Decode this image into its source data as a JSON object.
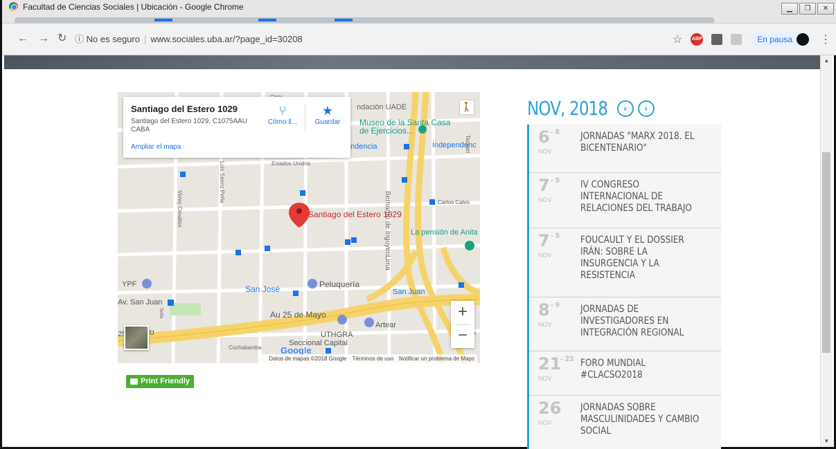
{
  "window": {
    "title": "Facultad de Ciencias Sociales | Ubicación - Google Chrome"
  },
  "address_bar": {
    "security": "No es seguro",
    "url": "www.sociales.uba.ar/?page_id=30208",
    "profile_status": "En pausa"
  },
  "map": {
    "place_name": "Santiago del Estero 1029",
    "address_line": "Santiago del Estero 1029, C1075AAU CABA",
    "directions_label": "Cómo ll...",
    "save_label": "Guardar",
    "enlarge_label": "Ampliar el mapa",
    "marker_label": "Santiago del Estero 1029",
    "labels": {
      "chile": "Chile",
      "uade": "ndación UADE",
      "museo": "Museo de la Santa Casa de Ejercicios...",
      "independencia1": "ndencia",
      "independencia2": "Independenc",
      "estados_unidos": "Estados Unidos",
      "bernardo": "Bernardo de Irigoyen",
      "carlos_calvo": "Carlos Calvo",
      "virrey": "Virrey Cevallos",
      "luis_saenz": "Luis Sáenz Peña",
      "pension": "La pensión de Anita",
      "lima": "Lima",
      "ypf": "YPF",
      "san_jose": "San José",
      "peluqueria": "Peluquería",
      "san_juan_metro": "San Juan",
      "av_san_juan": "Av. San Juan",
      "solis": "Solís",
      "au25": "Au 25 de Mayo",
      "yo": "yo",
      "num25": "25",
      "artear": "Artear",
      "uthgra": "UTHGRA",
      "seccional": "Seccional Capital",
      "cochabamba": "Cochabamba",
      "tacuari": "Tacuarí",
      "ba": "ba"
    },
    "google_logo": "Google",
    "attribution": [
      "Datos de mapas ©2018 Google",
      "Términos de uso",
      "Notificar un problema de Maps"
    ]
  },
  "print_button": "Print Friendly",
  "calendar": {
    "month_label": "NOV, 2018",
    "prev_icon": "chevron-left-icon",
    "next_icon": "chevron-right-icon",
    "events": [
      {
        "day": "6",
        "end": "- 8",
        "month": "NOV",
        "title": "JORNADAS \"MARX 2018. EL BICENTENARIO\""
      },
      {
        "day": "7",
        "end": "- 9",
        "month": "NOV",
        "title": "IV CONGRESO INTERNACIONAL DE RELACIONES DEL TRABAJO"
      },
      {
        "day": "7",
        "end": "- 9",
        "month": "NOV",
        "title": "FOUCAULT Y EL DOSSIER IRÁN: SOBRE LA INSURGENCIA Y LA RESISTENCIA"
      },
      {
        "day": "8",
        "end": "- 9",
        "month": "NOV",
        "title": "JORNADAS DE INVESTIGADORES EN INTEGRACIÓN REGIONAL"
      },
      {
        "day": "21",
        "end": "- 23",
        "month": "NOV",
        "title": "FORO MUNDIAL #CLACSO2018"
      },
      {
        "day": "26",
        "end": "",
        "month": "NOV",
        "title": "JORNADAS SOBRE MASCULINIDADES Y CAMBIO SOCIAL"
      }
    ]
  },
  "colors": {
    "accent": "#2aa3d8",
    "print_green": "#4cae32",
    "map_marker": "#d93025",
    "road_yellow": "#f6d36a"
  }
}
